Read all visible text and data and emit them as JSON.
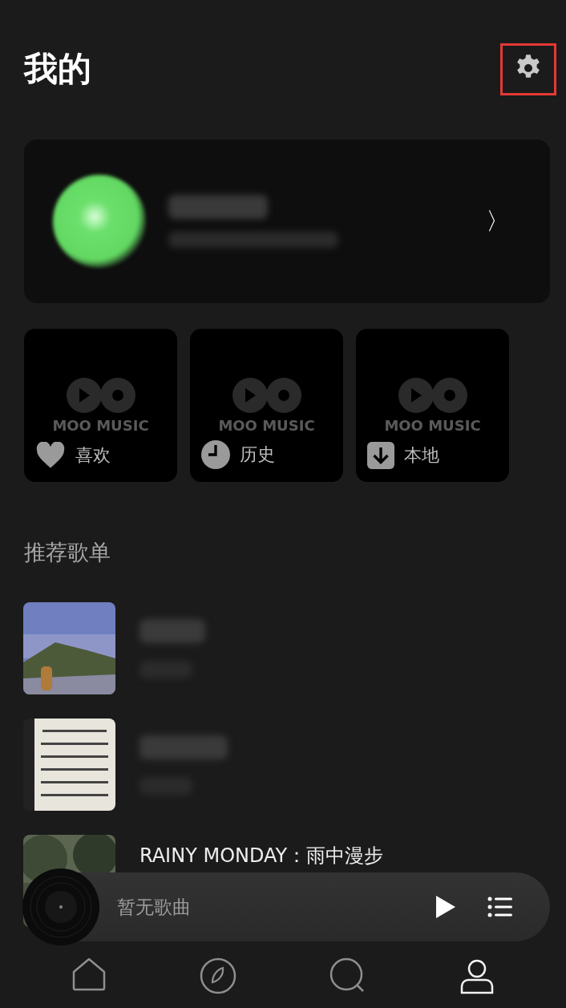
{
  "header": {
    "title": "我的",
    "settings": {
      "highlighted": true
    }
  },
  "account_card": {
    "chevron": "〉"
  },
  "shortcuts": [
    {
      "kind": "like",
      "label": "喜欢",
      "logo": "MOO MUSIC"
    },
    {
      "kind": "history",
      "label": "历史",
      "logo": "MOO MUSIC"
    },
    {
      "kind": "local",
      "label": "本地",
      "logo": "MOO MUSIC"
    }
  ],
  "recommended": {
    "title": "推荐歌单",
    "playlists": [
      {
        "kind": "picture",
        "blurred": true
      },
      {
        "kind": "picture",
        "blurred": true
      },
      {
        "kind": "picture",
        "blurred": false,
        "title": "RAINY MONDAY：雨中漫步"
      }
    ]
  },
  "player": {
    "song": "暂无歌曲"
  },
  "tab_bar": [
    {
      "kind": "home",
      "selected": false
    },
    {
      "kind": "discover",
      "selected": false
    },
    {
      "kind": "search",
      "selected": false
    },
    {
      "kind": "profile",
      "selected": true
    }
  ]
}
